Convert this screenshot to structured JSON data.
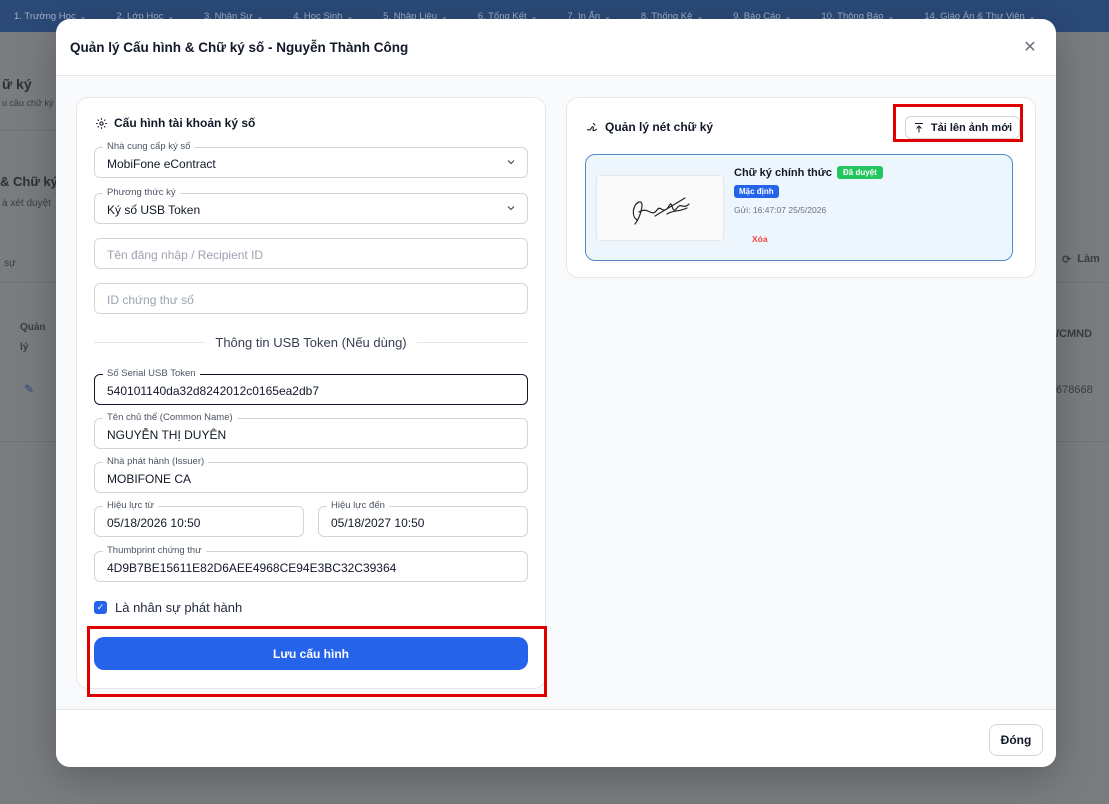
{
  "background": {
    "nav": [
      "1. Trường Học",
      "2. Lớp Học",
      "3. Nhân Sự",
      "4. Học Sinh",
      "5. Nhập Liệu",
      "6. Tổng Kết",
      "7. In Ấn",
      "8. Thống Kê",
      "9. Báo Cáo",
      "10. Thông Báo",
      "14. Giáo Án & Thư Viện"
    ],
    "page_title_fragment": "ữ ký",
    "page_subtitle_fragment": "u cầu chữ ký",
    "section_fragment": "& Chữ ký",
    "section_sub_fragment": "à xét duyệt",
    "search_fragment": "sự",
    "refresh_label": "Làm",
    "col_manage": "Quản lý",
    "col_id": "/CMND",
    "id_value": "678668"
  },
  "modal": {
    "title": "Quản lý Cấu hình & Chữ ký số - Nguyễn Thành Công",
    "close_icon": "✕",
    "left": {
      "section_title": "Cấu hình tài khoản ký số",
      "provider": {
        "label": "Nhà cung cấp ký số",
        "value": "MobiFone eContract"
      },
      "method": {
        "label": "Phương thức ký",
        "value": "Ký số USB Token"
      },
      "username": {
        "placeholder": "Tên đăng nhập / Recipient ID"
      },
      "cert_id": {
        "placeholder": "ID chứng thư số"
      },
      "usb_section_title": "Thông tin USB Token (Nếu dùng)",
      "serial": {
        "label": "Số Serial USB Token",
        "value": "540101140da32d8242012c0165ea2db7"
      },
      "common_name": {
        "label": "Tên chủ thể (Common Name)",
        "value": "NGUYỄN THỊ DUYÊN"
      },
      "issuer": {
        "label": "Nhà phát hành (Issuer)",
        "value": "MOBIFONE CA"
      },
      "valid_from": {
        "label": "Hiệu lực từ",
        "value": "05/18/2026  10:50"
      },
      "valid_to": {
        "label": "Hiệu lực đến",
        "value": "05/18/2027  10:50"
      },
      "thumbprint": {
        "label": "Thumbprint chứng thư",
        "value": "4D9B7BE15611E82D6AEE4968CE94E3BC32C39364"
      },
      "is_issuer_staff": {
        "label": "Là nhân sự phát hành",
        "checked": true
      },
      "save_button": "Lưu cấu hình"
    },
    "right": {
      "section_title": "Quản lý nét chữ ký",
      "upload_button": "Tải lên ảnh mới",
      "signature": {
        "name": "Chữ ký chính thức",
        "status_badge": "Đã duyệt",
        "default_badge": "Mặc định",
        "sent": "Gửi: 16:47:07 25/5/2026",
        "delete_label": "Xóa"
      }
    },
    "footer": {
      "close_button": "Đóng"
    }
  }
}
